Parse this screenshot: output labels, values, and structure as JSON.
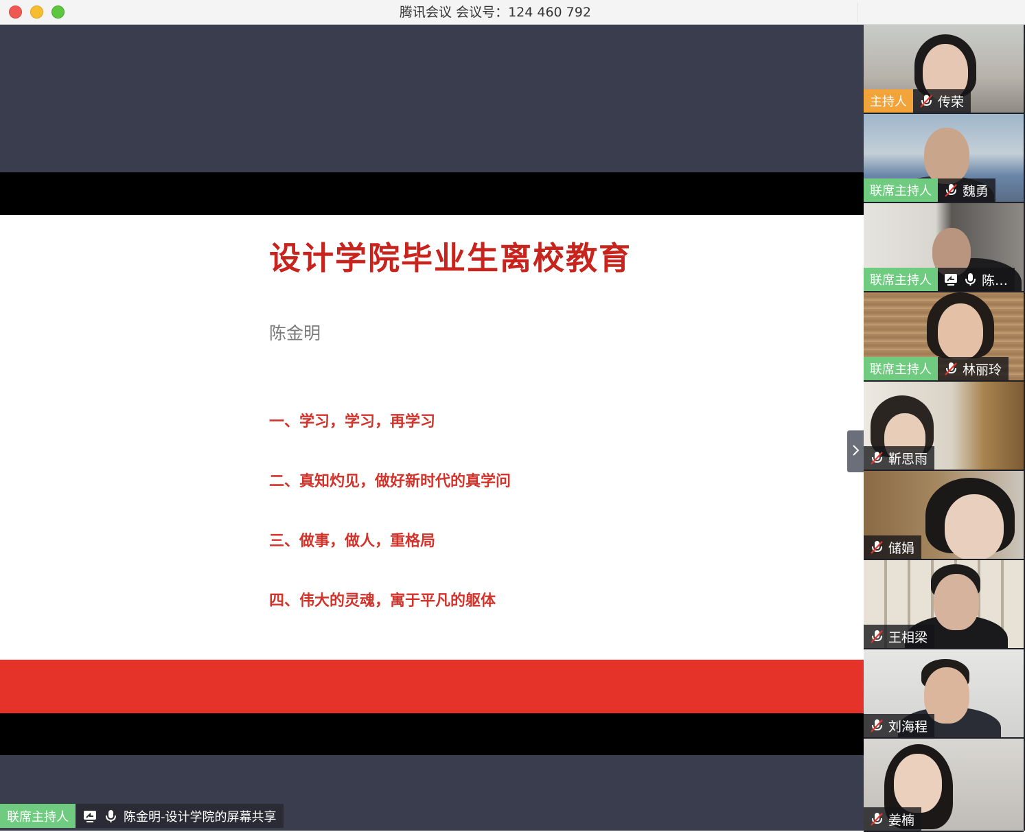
{
  "window": {
    "title": "腾讯会议 会议号：124 460 792"
  },
  "slide": {
    "title": "设计学院毕业生离校教育",
    "author": "陈金明",
    "points": [
      "一、学习，学习，再学习",
      "二、真知灼见，做好新时代的真学问",
      "三、做事，做人，重格局",
      "四、伟大的灵魂，寓于平凡的躯体"
    ]
  },
  "screen_share": {
    "role": "联席主持人",
    "label": "陈金明-设计学院的屏幕共享",
    "icons": [
      "screen-share-icon",
      "microphone-icon"
    ]
  },
  "participants": [
    {
      "role": "主持人",
      "name": "传荣",
      "mic": "muted"
    },
    {
      "role": "联席主持人",
      "name": "魏勇",
      "mic": "muted"
    },
    {
      "role": "联席主持人",
      "name": "陈…",
      "mic": "on",
      "sharing": true
    },
    {
      "role": "联席主持人",
      "name": "林丽玲",
      "mic": "muted"
    },
    {
      "role": "",
      "name": "靳思雨",
      "mic": "muted"
    },
    {
      "role": "",
      "name": "储娟",
      "mic": "muted"
    },
    {
      "role": "",
      "name": "王相梁",
      "mic": "muted"
    },
    {
      "role": "",
      "name": "刘海程",
      "mic": "muted"
    },
    {
      "role": "",
      "name": "姜楠",
      "mic": "muted"
    }
  ],
  "colors": {
    "host_badge": "#f2a33a",
    "cohost_badge": "#6fcb7f",
    "slide_title": "#c8241e",
    "slide_band": "#e5332a",
    "stage_bg": "#3a3d4e"
  }
}
